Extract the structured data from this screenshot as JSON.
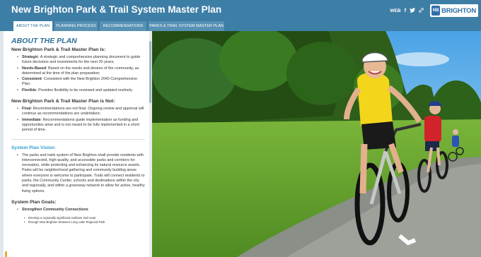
{
  "header": {
    "title": "New Brighton Park & Trail System Master Plan",
    "site_link": "WEB",
    "social_icons": [
      "facebook-icon",
      "twitter-icon",
      "link-icon"
    ],
    "logo_text": "BRIGHTON"
  },
  "tabs": [
    {
      "label": "ABOUT THE PLAN",
      "active": true
    },
    {
      "label": "PLANNING PROCESS",
      "active": false
    },
    {
      "label": "RECOMMENDATIONS",
      "active": false
    },
    {
      "label": "PARKS & TRAIL SYSTEM MASTER PLAN",
      "active": false
    }
  ],
  "panel": {
    "title": "ABOUT THE PLAN",
    "is_heading": "New Brighton Park & Trail Master Plan Is:",
    "is_items": [
      {
        "term": "Strategic",
        "text": ": A strategic and comprehensive planning document to guide future decisions and investments for the next 20 years;"
      },
      {
        "term": "Needs-Based",
        "text": ": Based on the needs and desires of the community, as determined at the time of the plan preparation;"
      },
      {
        "term": "Consistent",
        "text": ": Consistent with the New Brighton 2040 Comprehensive Plan;"
      },
      {
        "term": "Flexible",
        "text": ": Provides flexibility to be reviewed and updated routinely."
      }
    ],
    "not_heading": "New Brighton Park & Trail Master Plan is Not:",
    "not_items": [
      {
        "term": "Final",
        "text": ": Recommendations are not final. Ongoing review and approval will continue as recommendations are undertaken;"
      },
      {
        "term": "Immediate",
        "text": ": Recommendations guide implementation as funding and opportunities arise and is not meant to be fully implemented in a short period of time."
      }
    ],
    "vision_heading": "System Plan Vision:",
    "vision_items": [
      "The parks and trails system of New Brighton shall provide residents with interconnected, high-quality, and accessible parks and corridors for recreation, while protecting and enhancing its natural resource assets. Parks will be neighborhood gathering and community building areas where everyone is welcome to participate. Trails will connect residents to parks, the Community Center, schools and destinations within the city and regionally, and within a greenway network to allow for active, healthy living options."
    ],
    "goals_heading": "System Plan Goals:",
    "goal_items": [
      {
        "term": "Strengthen Community Connections",
        "text": ""
      }
    ],
    "goal_subitems": [
      "Develop a regionally significant multiuse trail route",
      "through New Brighton between Long Lake Regional Park"
    ]
  }
}
